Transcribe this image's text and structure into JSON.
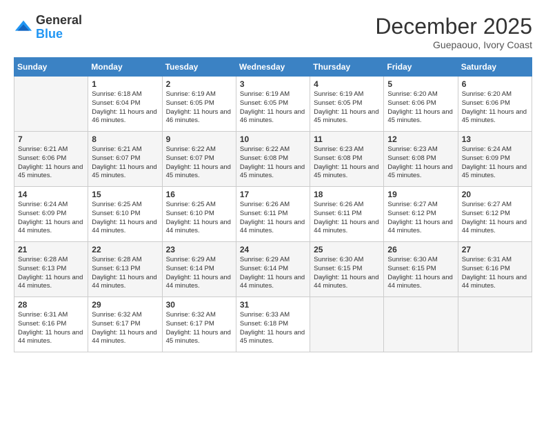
{
  "header": {
    "logo_general": "General",
    "logo_blue": "Blue",
    "month_year": "December 2025",
    "location": "Guepaouo, Ivory Coast"
  },
  "calendar": {
    "days_of_week": [
      "Sunday",
      "Monday",
      "Tuesday",
      "Wednesday",
      "Thursday",
      "Friday",
      "Saturday"
    ],
    "weeks": [
      [
        {
          "day": "",
          "sunrise": "",
          "sunset": "",
          "daylight": ""
        },
        {
          "day": "1",
          "sunrise": "Sunrise: 6:18 AM",
          "sunset": "Sunset: 6:04 PM",
          "daylight": "Daylight: 11 hours and 46 minutes."
        },
        {
          "day": "2",
          "sunrise": "Sunrise: 6:19 AM",
          "sunset": "Sunset: 6:05 PM",
          "daylight": "Daylight: 11 hours and 46 minutes."
        },
        {
          "day": "3",
          "sunrise": "Sunrise: 6:19 AM",
          "sunset": "Sunset: 6:05 PM",
          "daylight": "Daylight: 11 hours and 46 minutes."
        },
        {
          "day": "4",
          "sunrise": "Sunrise: 6:19 AM",
          "sunset": "Sunset: 6:05 PM",
          "daylight": "Daylight: 11 hours and 45 minutes."
        },
        {
          "day": "5",
          "sunrise": "Sunrise: 6:20 AM",
          "sunset": "Sunset: 6:06 PM",
          "daylight": "Daylight: 11 hours and 45 minutes."
        },
        {
          "day": "6",
          "sunrise": "Sunrise: 6:20 AM",
          "sunset": "Sunset: 6:06 PM",
          "daylight": "Daylight: 11 hours and 45 minutes."
        }
      ],
      [
        {
          "day": "7",
          "sunrise": "Sunrise: 6:21 AM",
          "sunset": "Sunset: 6:06 PM",
          "daylight": "Daylight: 11 hours and 45 minutes."
        },
        {
          "day": "8",
          "sunrise": "Sunrise: 6:21 AM",
          "sunset": "Sunset: 6:07 PM",
          "daylight": "Daylight: 11 hours and 45 minutes."
        },
        {
          "day": "9",
          "sunrise": "Sunrise: 6:22 AM",
          "sunset": "Sunset: 6:07 PM",
          "daylight": "Daylight: 11 hours and 45 minutes."
        },
        {
          "day": "10",
          "sunrise": "Sunrise: 6:22 AM",
          "sunset": "Sunset: 6:08 PM",
          "daylight": "Daylight: 11 hours and 45 minutes."
        },
        {
          "day": "11",
          "sunrise": "Sunrise: 6:23 AM",
          "sunset": "Sunset: 6:08 PM",
          "daylight": "Daylight: 11 hours and 45 minutes."
        },
        {
          "day": "12",
          "sunrise": "Sunrise: 6:23 AM",
          "sunset": "Sunset: 6:08 PM",
          "daylight": "Daylight: 11 hours and 45 minutes."
        },
        {
          "day": "13",
          "sunrise": "Sunrise: 6:24 AM",
          "sunset": "Sunset: 6:09 PM",
          "daylight": "Daylight: 11 hours and 45 minutes."
        }
      ],
      [
        {
          "day": "14",
          "sunrise": "Sunrise: 6:24 AM",
          "sunset": "Sunset: 6:09 PM",
          "daylight": "Daylight: 11 hours and 44 minutes."
        },
        {
          "day": "15",
          "sunrise": "Sunrise: 6:25 AM",
          "sunset": "Sunset: 6:10 PM",
          "daylight": "Daylight: 11 hours and 44 minutes."
        },
        {
          "day": "16",
          "sunrise": "Sunrise: 6:25 AM",
          "sunset": "Sunset: 6:10 PM",
          "daylight": "Daylight: 11 hours and 44 minutes."
        },
        {
          "day": "17",
          "sunrise": "Sunrise: 6:26 AM",
          "sunset": "Sunset: 6:11 PM",
          "daylight": "Daylight: 11 hours and 44 minutes."
        },
        {
          "day": "18",
          "sunrise": "Sunrise: 6:26 AM",
          "sunset": "Sunset: 6:11 PM",
          "daylight": "Daylight: 11 hours and 44 minutes."
        },
        {
          "day": "19",
          "sunrise": "Sunrise: 6:27 AM",
          "sunset": "Sunset: 6:12 PM",
          "daylight": "Daylight: 11 hours and 44 minutes."
        },
        {
          "day": "20",
          "sunrise": "Sunrise: 6:27 AM",
          "sunset": "Sunset: 6:12 PM",
          "daylight": "Daylight: 11 hours and 44 minutes."
        }
      ],
      [
        {
          "day": "21",
          "sunrise": "Sunrise: 6:28 AM",
          "sunset": "Sunset: 6:13 PM",
          "daylight": "Daylight: 11 hours and 44 minutes."
        },
        {
          "day": "22",
          "sunrise": "Sunrise: 6:28 AM",
          "sunset": "Sunset: 6:13 PM",
          "daylight": "Daylight: 11 hours and 44 minutes."
        },
        {
          "day": "23",
          "sunrise": "Sunrise: 6:29 AM",
          "sunset": "Sunset: 6:14 PM",
          "daylight": "Daylight: 11 hours and 44 minutes."
        },
        {
          "day": "24",
          "sunrise": "Sunrise: 6:29 AM",
          "sunset": "Sunset: 6:14 PM",
          "daylight": "Daylight: 11 hours and 44 minutes."
        },
        {
          "day": "25",
          "sunrise": "Sunrise: 6:30 AM",
          "sunset": "Sunset: 6:15 PM",
          "daylight": "Daylight: 11 hours and 44 minutes."
        },
        {
          "day": "26",
          "sunrise": "Sunrise: 6:30 AM",
          "sunset": "Sunset: 6:15 PM",
          "daylight": "Daylight: 11 hours and 44 minutes."
        },
        {
          "day": "27",
          "sunrise": "Sunrise: 6:31 AM",
          "sunset": "Sunset: 6:16 PM",
          "daylight": "Daylight: 11 hours and 44 minutes."
        }
      ],
      [
        {
          "day": "28",
          "sunrise": "Sunrise: 6:31 AM",
          "sunset": "Sunset: 6:16 PM",
          "daylight": "Daylight: 11 hours and 44 minutes."
        },
        {
          "day": "29",
          "sunrise": "Sunrise: 6:32 AM",
          "sunset": "Sunset: 6:17 PM",
          "daylight": "Daylight: 11 hours and 44 minutes."
        },
        {
          "day": "30",
          "sunrise": "Sunrise: 6:32 AM",
          "sunset": "Sunset: 6:17 PM",
          "daylight": "Daylight: 11 hours and 45 minutes."
        },
        {
          "day": "31",
          "sunrise": "Sunrise: 6:33 AM",
          "sunset": "Sunset: 6:18 PM",
          "daylight": "Daylight: 11 hours and 45 minutes."
        },
        {
          "day": "",
          "sunrise": "",
          "sunset": "",
          "daylight": ""
        },
        {
          "day": "",
          "sunrise": "",
          "sunset": "",
          "daylight": ""
        },
        {
          "day": "",
          "sunrise": "",
          "sunset": "",
          "daylight": ""
        }
      ]
    ]
  }
}
